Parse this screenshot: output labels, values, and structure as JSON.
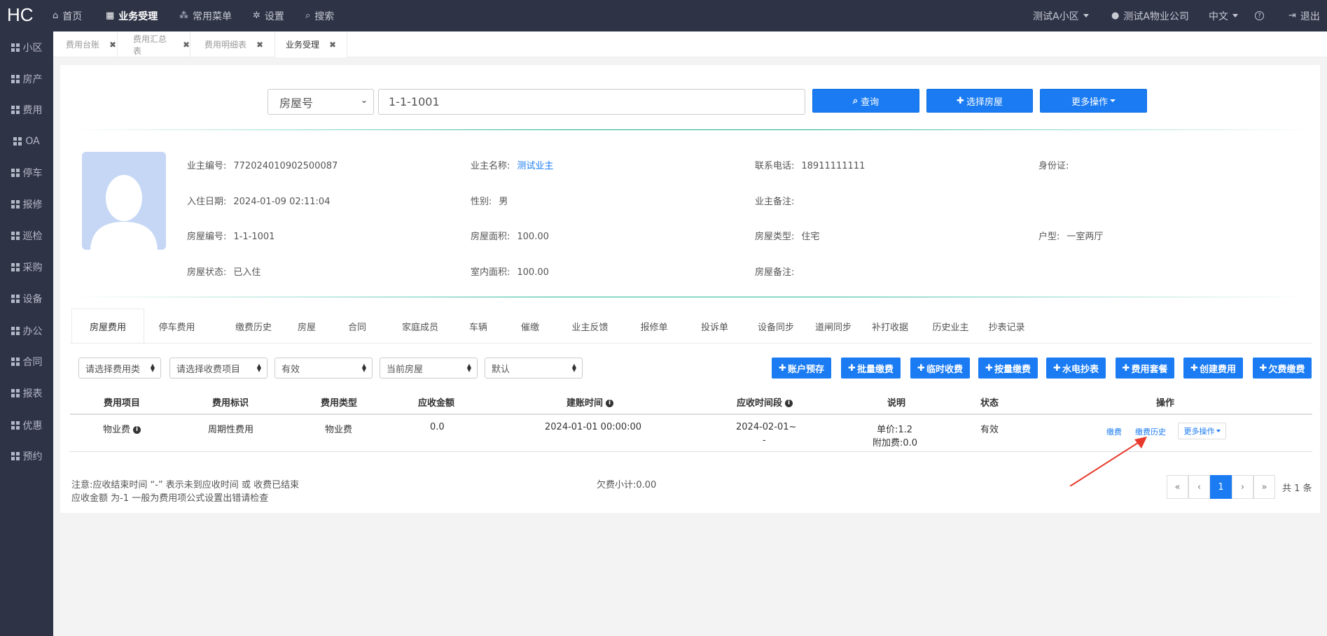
{
  "brand": "HC",
  "topnav": [
    {
      "label": "首页",
      "icon": "home-icon",
      "glyph": "⌂"
    },
    {
      "label": "业务受理",
      "icon": "calculator-icon",
      "glyph": "▦"
    },
    {
      "label": "常用菜单",
      "icon": "sitemap-icon",
      "glyph": "⁂"
    },
    {
      "label": "设置",
      "icon": "gear-icon",
      "glyph": "✲"
    },
    {
      "label": "搜索",
      "icon": "search-icon",
      "glyph": "⌕"
    }
  ],
  "topright": {
    "community": "测试A小区",
    "company": "测试A物业公司",
    "company_glyph": "●",
    "lang": "中文",
    "help": "?",
    "logout": "退出",
    "logout_glyph": "⇥"
  },
  "sidebar": [
    "小区",
    "房产",
    "费用",
    "OA",
    "停车",
    "报修",
    "巡检",
    "采购",
    "设备",
    "办公",
    "合同",
    "报表",
    "优惠",
    "预约"
  ],
  "page_tabs": [
    "费用台账",
    "费用汇总表",
    "费用明细表",
    "业务受理"
  ],
  "tab_close": "✖",
  "search": {
    "type": "房屋号",
    "value": "1-1-1001",
    "query": "查询",
    "select_room": "选择房屋",
    "more": "更多操作",
    "query_glyph": "⌕",
    "plus": "✚"
  },
  "owner": {
    "owner_no_label": "业主编号:",
    "owner_no": "772024010902500087",
    "owner_name_label": "业主名称:",
    "owner_name": "测试业主",
    "phone_label": "联系电话:",
    "phone": "18911111111",
    "id_label": "身份证:",
    "checkin_label": "入住日期:",
    "checkin": "2024-01-09 02:11:04",
    "gender_label": "性别:",
    "gender": "男",
    "owner_remark_label": "业主备注:",
    "room_no_label": "房屋编号:",
    "room_no": "1-1-1001",
    "area_label": "房屋面积:",
    "area": "100.00",
    "room_type_label": "房屋类型:",
    "room_type": "住宅",
    "layout_label": "户型:",
    "layout": "一室两厅",
    "status_label": "房屋状态:",
    "status": "已入住",
    "inner_area_label": "室内面积:",
    "inner_area": "100.00",
    "room_remark_label": "房屋备注:"
  },
  "func_tabs": [
    "房屋费用",
    "停车费用",
    "缴费历史",
    "房屋",
    "合同",
    "家庭成员",
    "车辆",
    "催缴",
    "业主反馈",
    "报修单",
    "投诉单",
    "设备同步",
    "道闸同步",
    "补打收据",
    "历史业主",
    "抄表记录"
  ],
  "filters": [
    "请选择费用类",
    "请选择收费项目",
    "有效",
    "当前房屋",
    "默认"
  ],
  "action_buttons": [
    "账户预存",
    "批量缴费",
    "临时收费",
    "按量缴费",
    "水电抄表",
    "费用套餐",
    "创建费用",
    "欠费缴费"
  ],
  "table": {
    "headers": [
      "费用项目",
      "费用标识",
      "费用类型",
      "应收金额",
      "建账时间",
      "应收时间段",
      "说明",
      "状态",
      "操作"
    ],
    "info_glyph": "i",
    "row": {
      "item": "物业费",
      "flag": "周期性费用",
      "type": "物业费",
      "amount": "0.0",
      "created": "2024-01-01 00:00:00",
      "period1": "2024-02-01~",
      "period2": "-",
      "desc1": "单价:1.2",
      "desc2": "附加费:0.0",
      "status": "有效",
      "op_pay": "缴费",
      "op_history": "缴费历史",
      "op_more": "更多操作"
    }
  },
  "footer": {
    "note1": "注意:应收结束时间 “-” 表示未到应收时间 或 收费已结束",
    "note2": "应收金额 为-1 一般为费用项公式设置出错请检查",
    "subtotal": "欠费小计:0.00"
  },
  "pagination": {
    "first": "«",
    "prev": "‹",
    "current": "1",
    "next": "›",
    "last": "»",
    "total": "共 1 条"
  },
  "colors": {
    "primary": "#1a7bf2",
    "sidebar": "#2f3346",
    "arrow": "#e83a2c"
  }
}
